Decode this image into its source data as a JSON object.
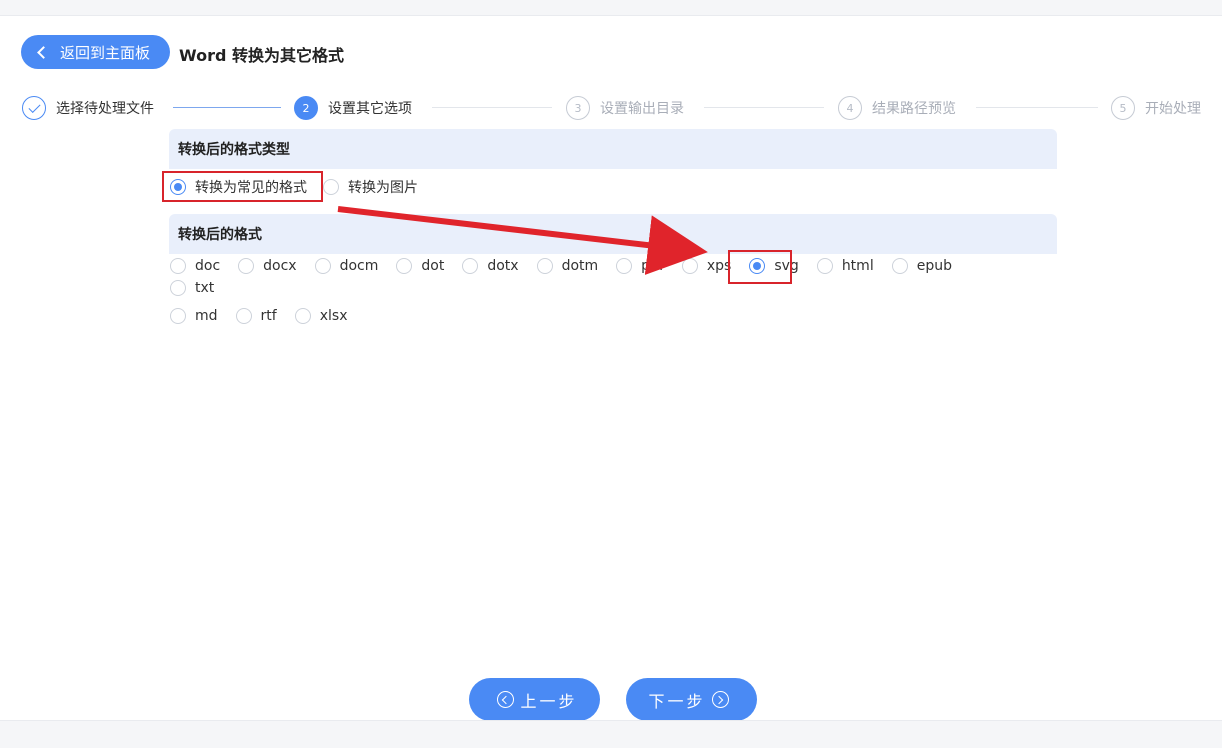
{
  "header": {
    "back_label": "返回到主面板",
    "title": "Word 转换为其它格式"
  },
  "steps": [
    {
      "label": "选择待处理文件",
      "num": "",
      "state": "done"
    },
    {
      "label": "设置其它选项",
      "num": "2",
      "state": "active"
    },
    {
      "label": "设置输出目录",
      "num": "3",
      "state": "pending"
    },
    {
      "label": "结果路径预览",
      "num": "4",
      "state": "pending"
    },
    {
      "label": "开始处理",
      "num": "5",
      "state": "pending"
    }
  ],
  "type_section": {
    "heading": "转换后的格式类型",
    "options": [
      {
        "label": "转换为常见的格式",
        "checked": true
      },
      {
        "label": "转换为图片",
        "checked": false
      }
    ]
  },
  "format_section": {
    "heading": "转换后的格式",
    "options": [
      {
        "label": "doc",
        "checked": false
      },
      {
        "label": "docx",
        "checked": false
      },
      {
        "label": "docm",
        "checked": false
      },
      {
        "label": "dot",
        "checked": false
      },
      {
        "label": "dotx",
        "checked": false
      },
      {
        "label": "dotm",
        "checked": false
      },
      {
        "label": "pdf",
        "checked": false
      },
      {
        "label": "xps",
        "checked": false
      },
      {
        "label": "svg",
        "checked": true
      },
      {
        "label": "html",
        "checked": false
      },
      {
        "label": "epub",
        "checked": false
      },
      {
        "label": "txt",
        "checked": false
      },
      {
        "label": "md",
        "checked": false
      },
      {
        "label": "rtf",
        "checked": false
      },
      {
        "label": "xlsx",
        "checked": false
      }
    ]
  },
  "footer": {
    "prev_label": "上一步",
    "next_label": "下一步"
  },
  "colors": {
    "accent": "#4a8af4",
    "highlight": "#d8242b",
    "section_bg": "#e9effb"
  }
}
